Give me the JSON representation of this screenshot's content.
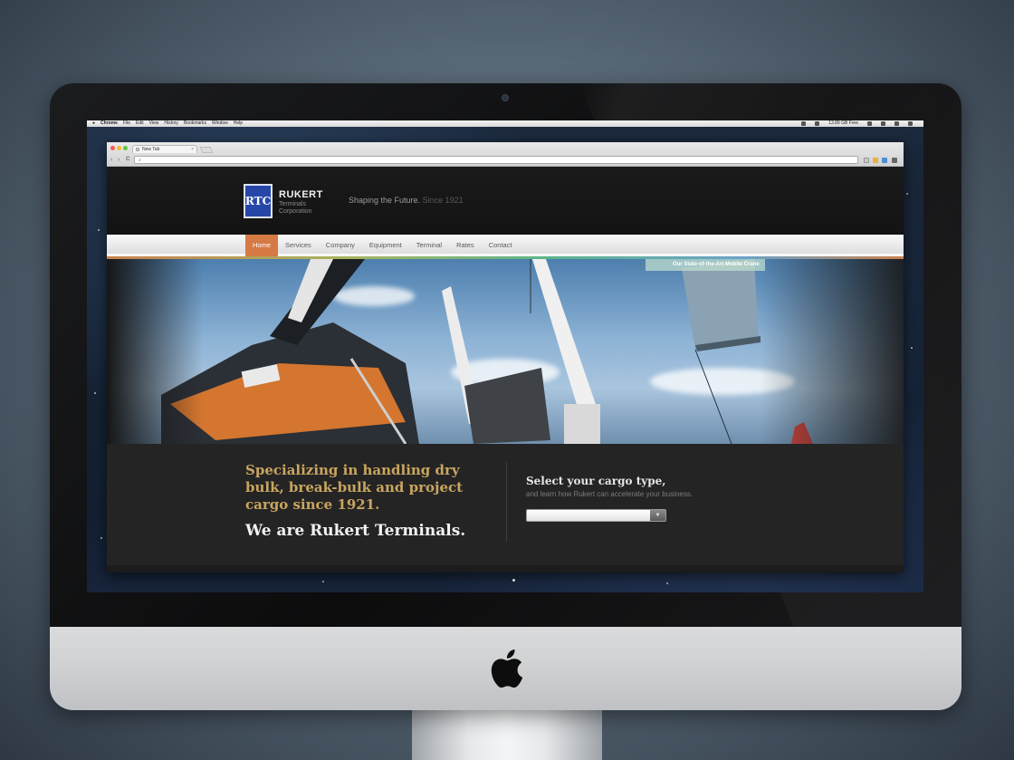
{
  "mac_menubar": {
    "items": [
      "Chrome",
      "File",
      "Edit",
      "View",
      "History",
      "Bookmarks",
      "Window",
      "Help"
    ],
    "status_text": "13.89 GB Free"
  },
  "browser": {
    "tab_title": "New Tab",
    "tab_close": "×",
    "back_icon": "‹",
    "forward_icon": "›",
    "reload_icon": "C",
    "search_icon": "⌕"
  },
  "site": {
    "logo_text": "RTC",
    "brand_name": "RUKERT",
    "brand_sub_line1": "Terminals",
    "brand_sub_line2": "Corporation",
    "tagline_main": "Shaping the Future.",
    "tagline_since": "Since 1921",
    "nav": [
      {
        "label": "Home",
        "active": true
      },
      {
        "label": "Services"
      },
      {
        "label": "Company"
      },
      {
        "label": "Equipment"
      },
      {
        "label": "Terminal"
      },
      {
        "label": "Rates"
      },
      {
        "label": "Contact"
      }
    ],
    "hero": {
      "caption": "Our State-of-the-Art Mobile Crane",
      "prev_icon": "‹",
      "next_icon": "›"
    },
    "info": {
      "headline": "Specializing in handling dry bulk, break-bulk and project cargo since 1921.",
      "we_are": "We are Rukert Terminals.",
      "cargo_title": "Select your cargo type,",
      "cargo_sub": "and learn how Rukert can accelerate your business.",
      "select_value": "",
      "select_arrow": "▼"
    }
  },
  "colors": {
    "accent_orange": "#d57a45",
    "headline_gold": "#c9a55f",
    "logo_blue": "#2747a8"
  }
}
